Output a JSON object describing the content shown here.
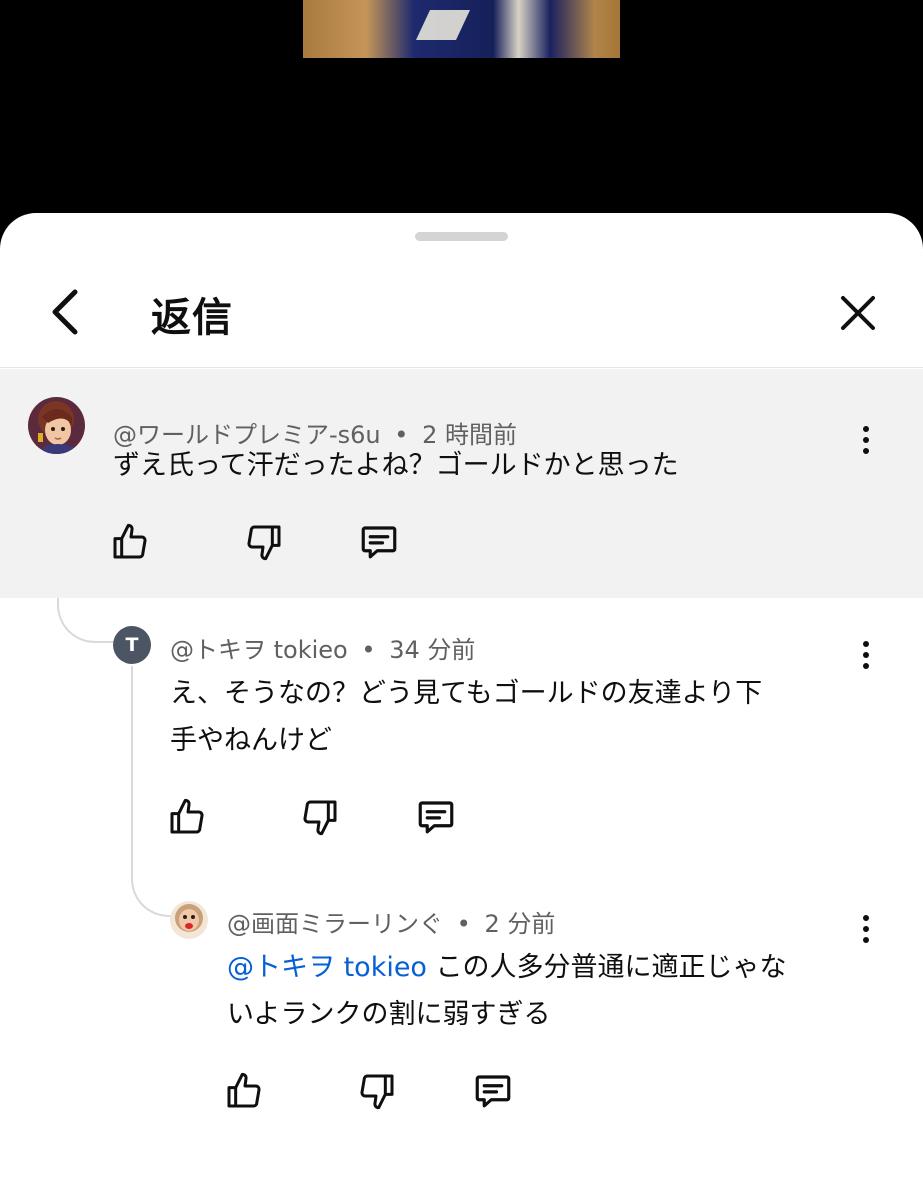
{
  "header": {
    "title": "返信"
  },
  "comments": [
    {
      "author": "@ワールドプレミア-s6u",
      "separator": "•",
      "time": "2 時間前",
      "text": "ずえ氏って汗だったよね？ゴールドかと思った"
    },
    {
      "author": "@トキヲ tokieo",
      "separator": "•",
      "time": "34 分前",
      "avatar_initial": "T",
      "text_line1": "え、そうなの？どう見てもゴールドの友達より下",
      "text_line2": "手やねんけど"
    },
    {
      "author": "@画面ミラーリンぐ",
      "separator": "•",
      "time": "2 分前",
      "mention": "@トキヲ tokieo",
      "text_line1": "この人多分普通に適正じゃな",
      "text_line2": "いよランクの割に弱すぎる"
    }
  ],
  "colors": {
    "mention": "#065fd4",
    "highlight_bg": "#f2f2f2",
    "meta": "#606060"
  }
}
